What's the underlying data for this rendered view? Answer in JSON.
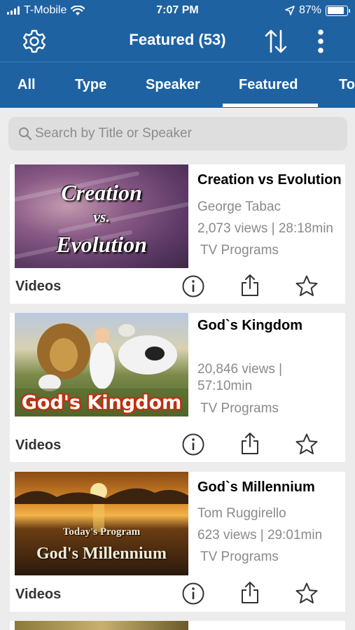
{
  "status_bar": {
    "carrier": "T-Mobile",
    "time": "7:07 PM",
    "battery": "87%",
    "battery_level": 0.87,
    "icons": [
      "signal-icon",
      "wifi-icon",
      "location-arrow-icon",
      "battery-icon"
    ]
  },
  "nav": {
    "title": "Featured (53)",
    "icons": [
      "gear-icon",
      "sort-icon",
      "more-vertical-icon"
    ]
  },
  "tabs": [
    {
      "label": "All"
    },
    {
      "label": "Type"
    },
    {
      "label": "Speaker"
    },
    {
      "label": "Featured",
      "active": true
    },
    {
      "label": "To"
    }
  ],
  "search": {
    "placeholder": "Search by Title or Speaker",
    "value": ""
  },
  "items": [
    {
      "title": "Creation vs Evolution",
      "speaker": "George Tabac",
      "views_duration": "2,073 views | 28:18min",
      "category": "TV Programs",
      "type_label": "Videos",
      "thumb_text": [
        "Creation",
        "vs.",
        "Evolution"
      ]
    },
    {
      "title": "God`s Kingdom",
      "speaker": "",
      "views_line1": "20,846 views |",
      "views_line2": "57:10min",
      "category": "TV Programs",
      "type_label": "Videos",
      "thumb_text": "God's Kingdom"
    },
    {
      "title": "God`s Millennium",
      "speaker": "Tom Ruggirello",
      "views_duration": "623 views | 29:01min",
      "category": "TV Programs",
      "type_label": "Videos",
      "thumb_text": [
        "Today's Program",
        "God's Millennium"
      ]
    }
  ],
  "actions": [
    "info-icon",
    "share-icon",
    "star-icon"
  ],
  "colors": {
    "header_blue": "#1f62a1",
    "background": "#ececec",
    "card": "#ffffff",
    "meta_gray": "#8a8a8a"
  }
}
